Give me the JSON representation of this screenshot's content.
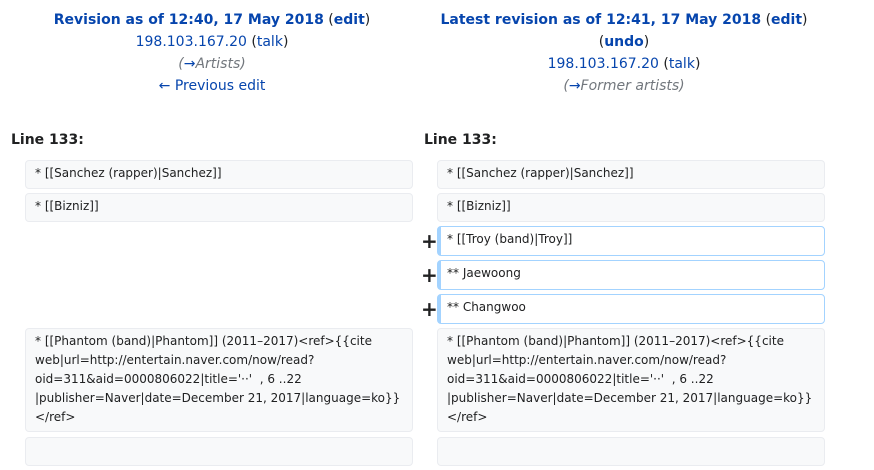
{
  "left_header": {
    "title": "Revision as of 12:40, 17 May 2018",
    "edit_label": "edit",
    "user": "198.103.167.20",
    "talk_label": "talk",
    "arrow": "→",
    "section": "Artists",
    "prev_label": "← Previous edit"
  },
  "right_header": {
    "title": "Latest revision as of 12:41, 17 May 2018",
    "edit_label": "edit",
    "undo_label": "undo",
    "user": "198.103.167.20",
    "talk_label": "talk",
    "arrow": "→",
    "section": "Former artists"
  },
  "line_left": "Line 133:",
  "line_right": "Line 133:",
  "added_marker": "+",
  "rows": {
    "ctx1": "* [[Sanchez (rapper)|Sanchez]]",
    "ctx2": "* [[Bizniz]]",
    "add1": "* [[Troy (band)|Troy]]",
    "add2": "** Jaewoong",
    "add3": "** Changwoo",
    "ctx3": "* [[Phantom (band)|Phantom]] (2011–2017)<ref>{{cite web|url=http://entertain.naver.com/now/read?oid=311&aid=0000806022|title='··'  , 6 ..22 |publisher=Naver|date=December 21, 2017|language=ko}}</ref>",
    "ctx4": ""
  }
}
